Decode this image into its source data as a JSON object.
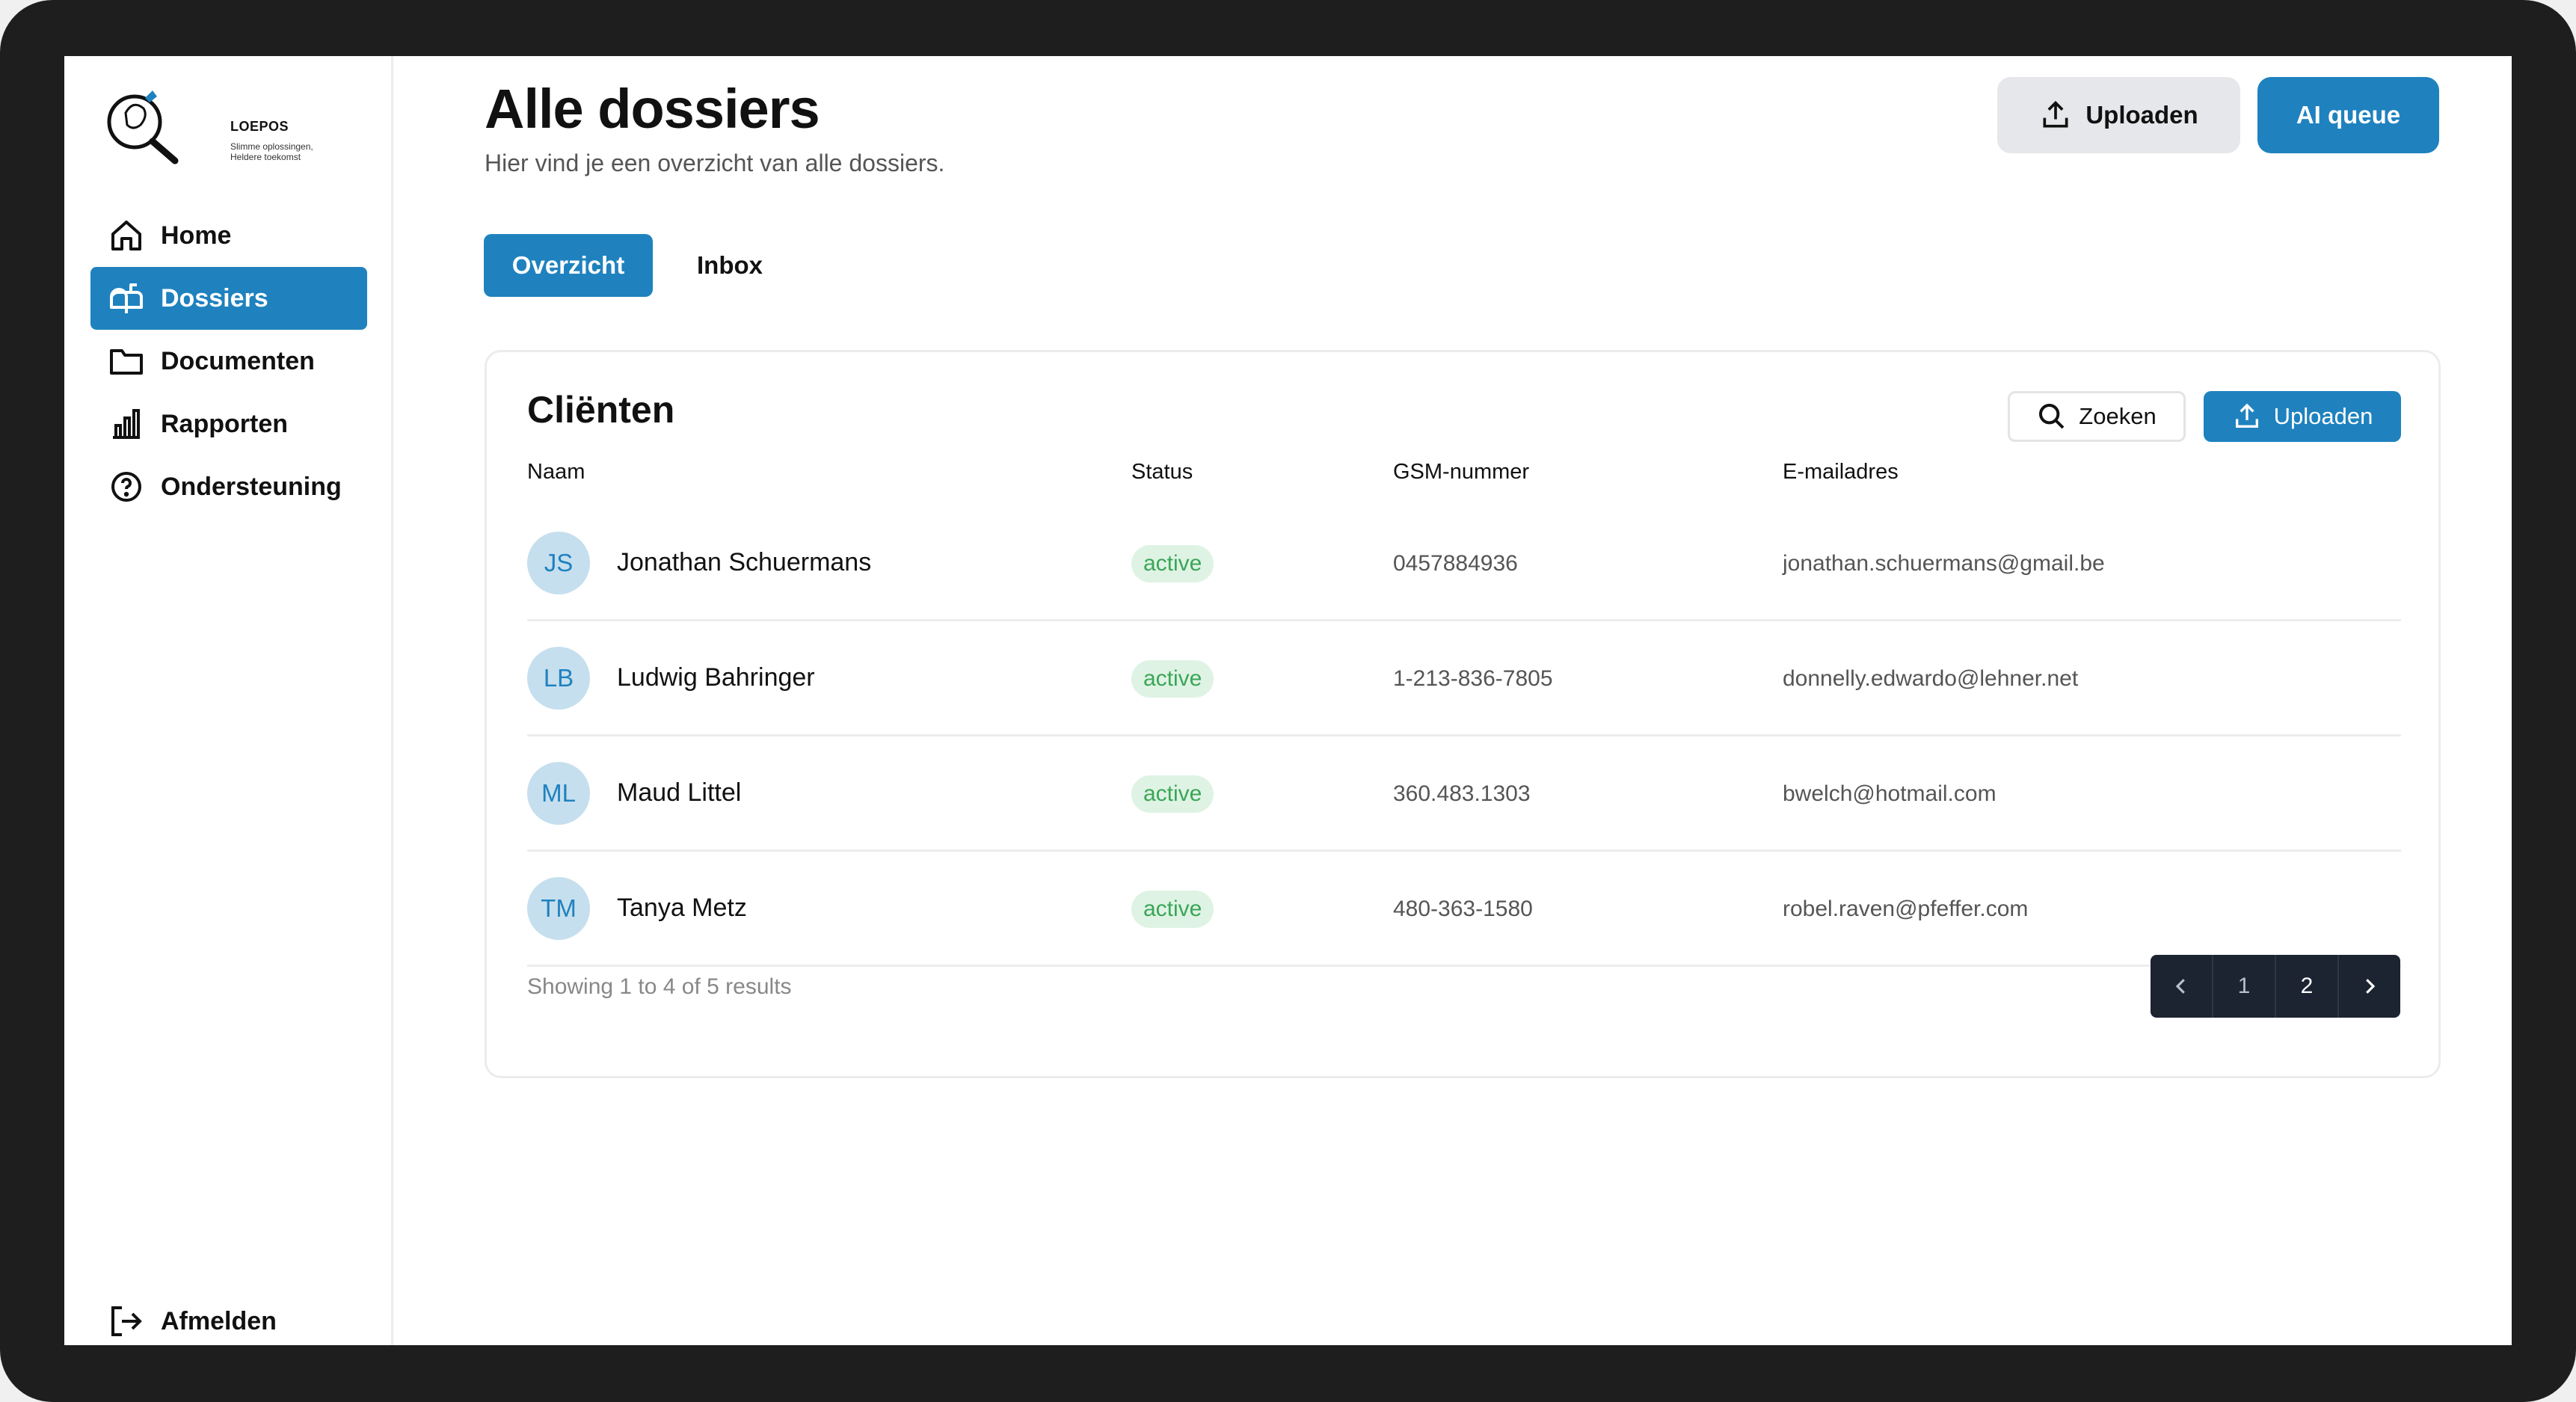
{
  "app": {
    "logo_title": "LOEPOS",
    "logo_subtitle": "Slimme oplossingen, Heldere toekomst"
  },
  "sidebar": {
    "items": [
      {
        "label": "Home",
        "icon": "home-icon"
      },
      {
        "label": "Dossiers",
        "icon": "mailbox-icon",
        "active": true
      },
      {
        "label": "Documenten",
        "icon": "folder-icon"
      },
      {
        "label": "Rapporten",
        "icon": "bar-chart-icon"
      },
      {
        "label": "Ondersteuning",
        "icon": "help-circle-icon"
      }
    ],
    "logout_label": "Afmelden"
  },
  "header": {
    "title": "Alle dossiers",
    "subtitle": "Hier vind je een overzicht van alle dossiers.",
    "upload_label": "Uploaden",
    "ai_queue_label": "AI queue"
  },
  "tabs": [
    {
      "label": "Overzicht",
      "active": true
    },
    {
      "label": "Inbox",
      "active": false
    }
  ],
  "clients": {
    "title": "Cliënten",
    "search_label": "Zoeken",
    "upload_label": "Uploaden",
    "columns": [
      "Naam",
      "Status",
      "GSM-nummer",
      "E-mailadres"
    ],
    "rows": [
      {
        "initials": "JS",
        "name": "Jonathan Schuermans",
        "status": "active",
        "phone": "0457884936",
        "email": "jonathan.schuermans@gmail.be"
      },
      {
        "initials": "LB",
        "name": "Ludwig Bahringer",
        "status": "active",
        "phone": "1-213-836-7805",
        "email": "donnelly.edwardo@lehner.net"
      },
      {
        "initials": "ML",
        "name": "Maud Littel",
        "status": "active",
        "phone": "360.483.1303",
        "email": "bwelch@hotmail.com"
      },
      {
        "initials": "TM",
        "name": "Tanya Metz",
        "status": "active",
        "phone": "480-363-1580",
        "email": "robel.raven@pfeffer.com"
      }
    ],
    "footer": "Showing 1 to 4 of 5 results",
    "pagination": {
      "pages": [
        "1",
        "2"
      ],
      "current": "2"
    }
  },
  "colors": {
    "accent": "#1f82bf",
    "status_active_bg": "#dff3e4",
    "status_active_text": "#3aa657",
    "pager_bg": "#1c2331"
  }
}
